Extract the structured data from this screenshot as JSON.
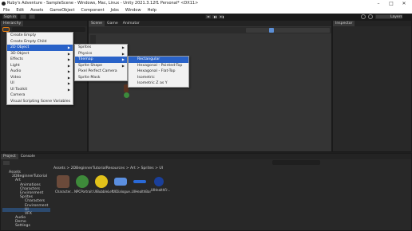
{
  "window": {
    "title": "Ruby's Adventure - SampleScene - Windows, Mac, Linux - Unity 2021.3.12f1 Personal* <DX11>",
    "minimize": "–",
    "maximize": "□",
    "close": "✕"
  },
  "menubar": {
    "items": [
      "File",
      "Edit",
      "Assets",
      "GameObject",
      "Component",
      "Jobs",
      "Window",
      "Help"
    ]
  },
  "toolbar": {
    "signin_label": "Sign in",
    "layers_label": "Layers"
  },
  "hierarchy": {
    "tab_label": "Hierarchy"
  },
  "scene": {
    "tabs": [
      "Scene",
      "Game",
      "Animator"
    ]
  },
  "inspector": {
    "tab_label": "Inspector"
  },
  "context_menu": {
    "items": [
      "Create Empty",
      "Create Empty Child",
      "2D Object",
      "3D Object",
      "Effects",
      "Light",
      "Audio",
      "Video",
      "UI",
      "UI Toolkit",
      "Camera",
      "Visual Scripting Scene Variables"
    ]
  },
  "submenu_2d": {
    "items": [
      "Sprites",
      "Physics",
      "Tilemap",
      "Sprite Shape",
      "Pixel Perfect Camera",
      "Sprite Mask"
    ]
  },
  "submenu_tilemap": {
    "items": [
      "Rectangular",
      "Hexagonal - Pointed-Top",
      "Hexagonal - Flat-Top",
      "Isometric",
      "Isometric Z as Y"
    ]
  },
  "project": {
    "tabs": [
      "Project",
      "Console"
    ],
    "breadcrumb": "Assets > 2DBeginnerTutorialResources > Art > Sprites > UI",
    "tree": [
      "Assets",
      "2DBeginnerTutorial",
      "Art",
      "Animations",
      "Characters",
      "Environment",
      "Sprites",
      "Characters",
      "Environment",
      "UI",
      "VFX",
      "Audio",
      "Demo",
      "Settings"
    ],
    "assets": [
      "Character...",
      "NPCPortrait",
      "UIBubbleLeft",
      "UIDialogue...",
      "UIHealthBar",
      "UIHealthFr..."
    ]
  },
  "colors": {
    "accent": "#2962c8",
    "panel": "#282828",
    "background": "#1e1e1e"
  }
}
